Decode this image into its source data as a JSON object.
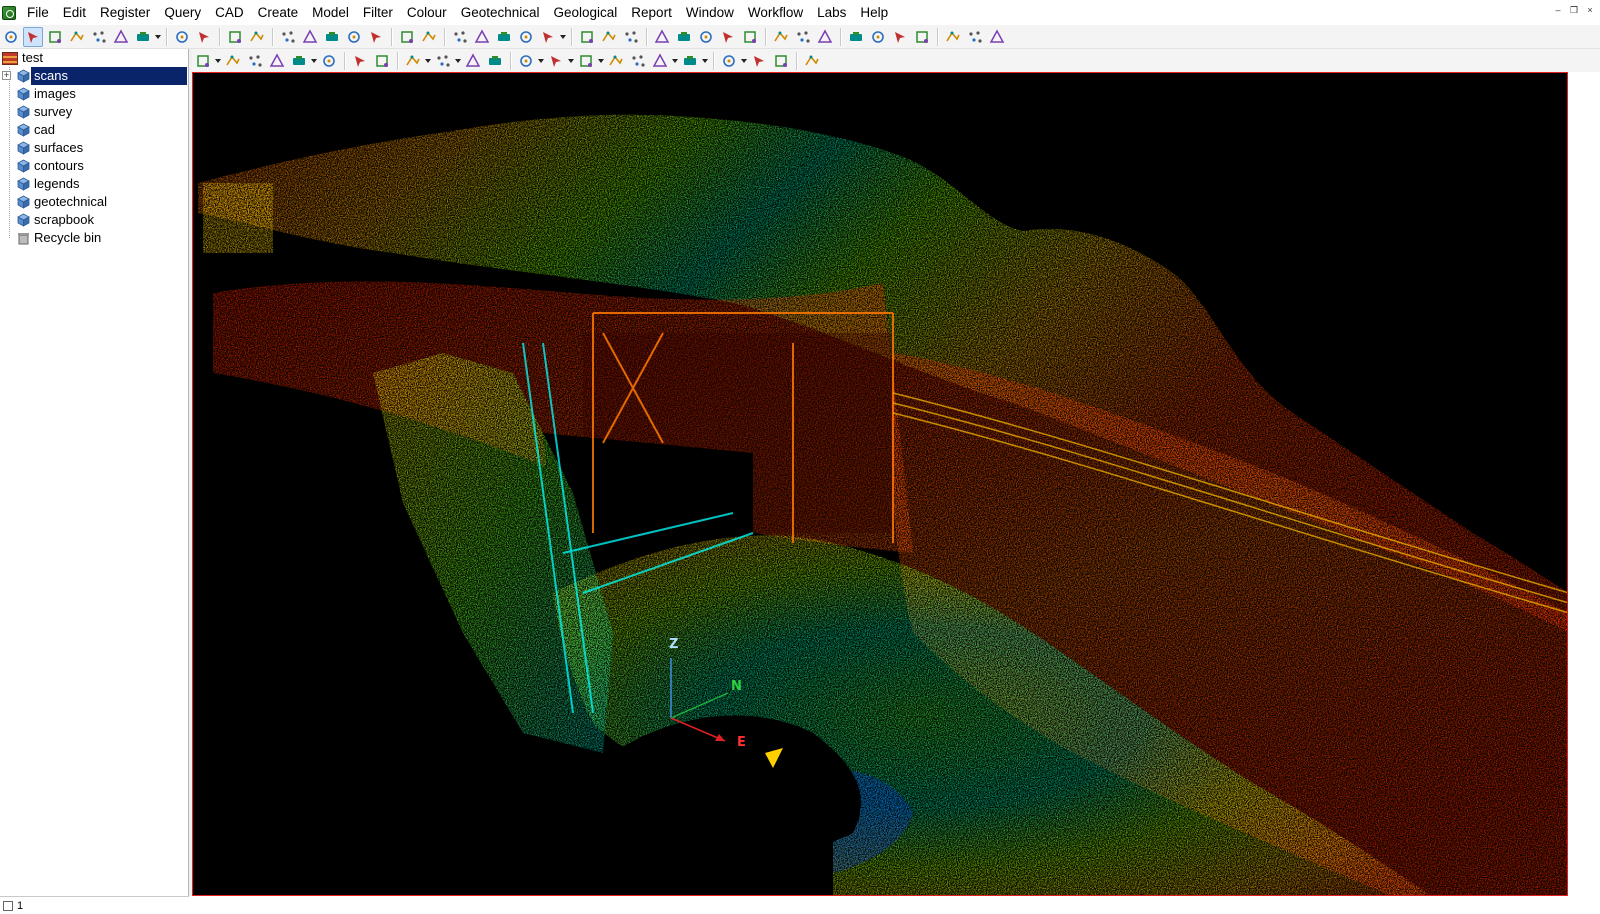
{
  "menu": {
    "items": [
      "File",
      "Edit",
      "Register",
      "Query",
      "CAD",
      "Create",
      "Model",
      "Filter",
      "Colour",
      "Geotechnical",
      "Geological",
      "Report",
      "Window",
      "Workflow",
      "Labs",
      "Help"
    ]
  },
  "window_controls": {
    "minimize": "–",
    "restore": "❐",
    "close": "×"
  },
  "tree": {
    "root": "test",
    "items": [
      {
        "label": "scans",
        "selected": true,
        "expandable": true
      },
      {
        "label": "images"
      },
      {
        "label": "survey"
      },
      {
        "label": "cad"
      },
      {
        "label": "surfaces"
      },
      {
        "label": "contours"
      },
      {
        "label": "legends"
      },
      {
        "label": "geotechnical"
      },
      {
        "label": "scrapbook"
      },
      {
        "label": "Recycle bin",
        "type": "recycle"
      }
    ]
  },
  "status": {
    "value": "1"
  },
  "viewport": {
    "axes": {
      "z": "Z",
      "n": "N",
      "e": "E"
    },
    "colors": {
      "border": "#e02020",
      "background": "#000000",
      "axis_x": "#e02020",
      "axis_y": "#20b040",
      "axis_z": "#4090e0"
    }
  },
  "toolbar1": [
    "hand-icon",
    "select-arrow-icon",
    "select-points-icon",
    "pick-line-icon",
    "pick-fill-icon",
    "pick-box-icon",
    "view-box-icon",
    "hatch-icon",
    "undo-icon",
    "redo-icon",
    "cut-icon",
    "copy-icon",
    "paste-icon",
    "delete-icon",
    "crop-icon",
    "query-icon",
    "query-tag-icon",
    "points-icon",
    "multi-points-icon",
    "text-points-icon",
    "move-points-icon",
    "remove-points-icon",
    "filter-icon",
    "swap-icon",
    "refresh-icon",
    "nodes-icon",
    "polyline-icon",
    "triangle-icon",
    "network-icon",
    "star-icon",
    "cluster-icon",
    "cluster-red-icon",
    "cluster-alt-icon",
    "cube-flag-icon",
    "colour-sphere-icon",
    "colour-ramp-icon",
    "colour-scan-icon",
    "curve-icon",
    "globe-icon",
    "globe-red-icon",
    "target-icon"
  ],
  "toolbar2": [
    "box-view-icon",
    "camera-move-icon",
    "video-icon",
    "axis-icon",
    "z-axis-icon",
    "window-copy-icon",
    "fit-points-icon",
    "zoom-icon",
    "layer-move-icon",
    "light-icon",
    "speaker-icon",
    "grid-icon",
    "terrain-icon",
    "shade-icon",
    "nodes-view-icon",
    "brightness-icon",
    "eye-icon",
    "cube-view-icon",
    "split-icon",
    "export-icon",
    "snapshot-icon",
    "play-icon",
    "list-icon"
  ]
}
